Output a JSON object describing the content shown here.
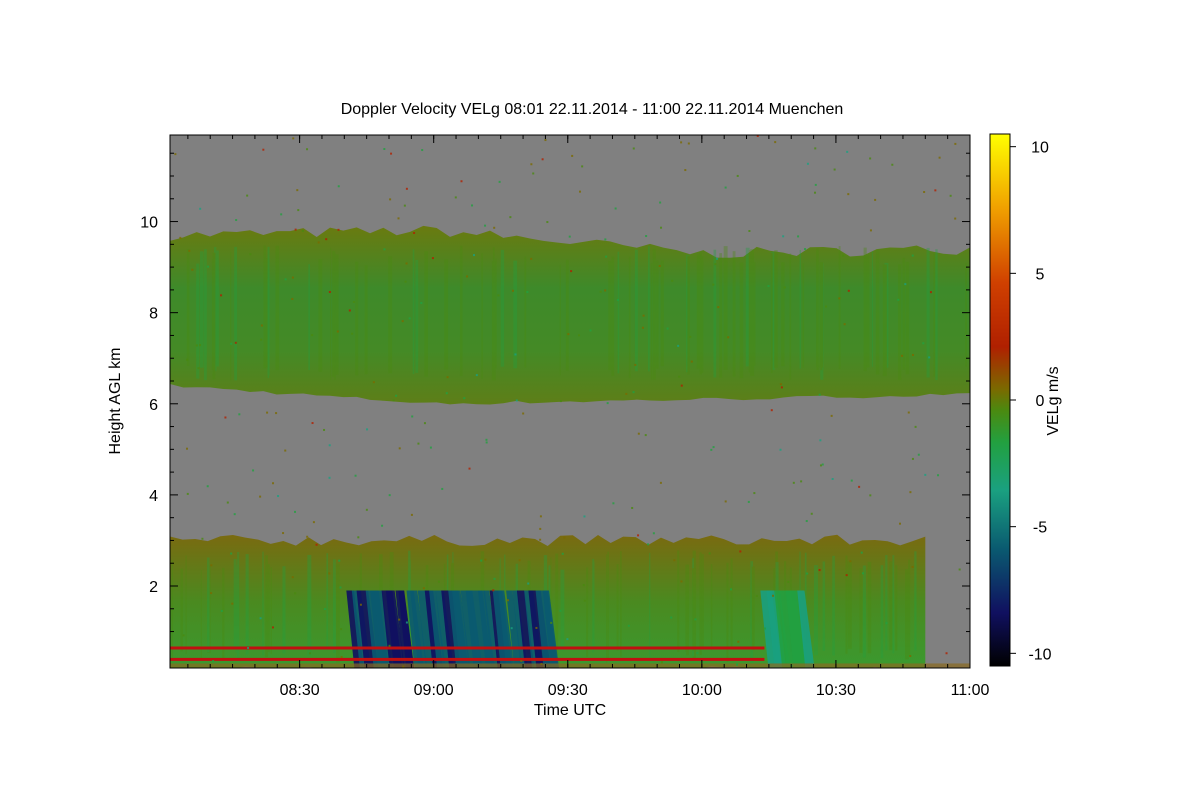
{
  "chart_data": {
    "type": "heatmap",
    "title": "Doppler Velocity VELg   08:01 22.11.2014 - 11:00 22.11.2014 Muenchen",
    "xlabel": "Time UTC",
    "ylabel": "Height AGL km",
    "xlim": [
      "08:01",
      "11:00"
    ],
    "ylim": [
      0.2,
      11.9
    ],
    "x_ticks": [
      "08:30",
      "09:00",
      "09:30",
      "10:00",
      "10:30",
      "11:00"
    ],
    "y_ticks": [
      2,
      4,
      6,
      8,
      10
    ],
    "colorbar": {
      "label": "VELg m/s",
      "range": [
        -10.5,
        10.5
      ],
      "ticks": [
        10,
        5,
        0,
        -5,
        -10
      ],
      "colors": [
        "#000000",
        "#101060",
        "#0a5a70",
        "#1aa080",
        "#22a040",
        "#4a8a10",
        "#7a6a00",
        "#b02000",
        "#d04000",
        "#f0a000",
        "#ffff00"
      ]
    },
    "background_color": "#808080",
    "regions": [
      {
        "name": "upper cloud layer",
        "time_start": "08:01",
        "time_end": "11:00",
        "height_bottom_km": [
          6.4,
          6.0,
          6.1,
          6.2
        ],
        "height_top_km": [
          9.7,
          9.8,
          9.3,
          9.4
        ],
        "velocity_m_s": -0.5
      },
      {
        "name": "lower precipitation layer",
        "time_start": "08:01",
        "time_end": "10:50",
        "height_bottom_km": 0.2,
        "height_top_km": 3.0,
        "velocity_m_s": -1.0
      },
      {
        "name": "fall streaks",
        "time_start": "08:40",
        "time_end": "09:25",
        "height_bottom_km": 0.2,
        "height_top_km": 1.9,
        "velocity_m_s": -7.5
      },
      {
        "name": "fall streaks",
        "time_start": "10:13",
        "time_end": "10:22",
        "height_bottom_km": 0.2,
        "height_top_km": 1.9,
        "velocity_m_s": -4.0
      }
    ]
  }
}
